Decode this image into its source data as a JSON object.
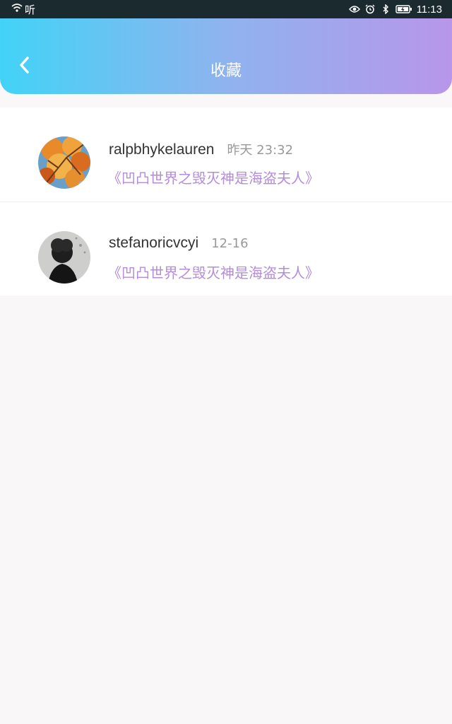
{
  "status_bar": {
    "left_text": "听",
    "time": "11:13",
    "icons": [
      "wifi-icon",
      "eye-icon",
      "alarm-icon",
      "bluetooth-icon",
      "battery-icon"
    ]
  },
  "header": {
    "title": "收藏",
    "back_icon": "chevron-left-icon",
    "gradient_colors": [
      "#42d3f7",
      "#b896ea"
    ]
  },
  "favorites": [
    {
      "username": "ralpbhykelauren",
      "time": "昨天 23:32",
      "book_title": "《凹凸世界之毁灭神是海盗夫人》",
      "avatar": "autumn-leaves-avatar"
    },
    {
      "username": "stefanoricvcyi",
      "time": "12-16",
      "book_title": "《凹凸世界之毁灭神是海盗夫人》",
      "avatar": "silhouette-avatar"
    }
  ],
  "colors": {
    "accent_purple": "#b38cdc",
    "username": "#333333",
    "time": "#999999",
    "background": "#f9f7f8"
  }
}
